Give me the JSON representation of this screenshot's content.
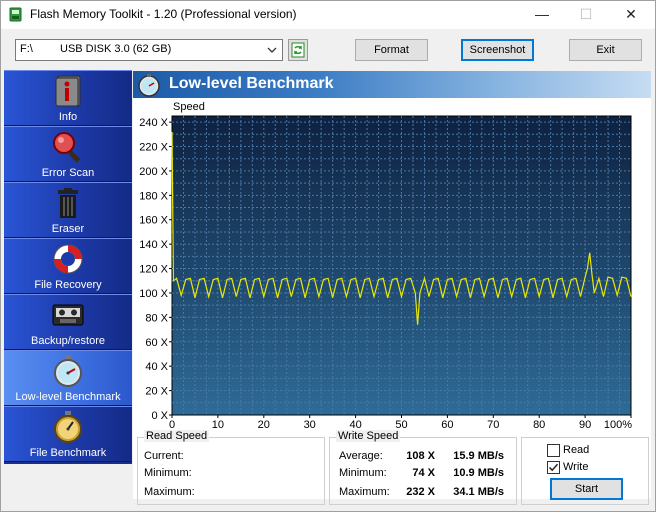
{
  "window": {
    "title": "Flash Memory Toolkit - 1.20 (Professional version)",
    "minimize_glyph": "—",
    "maximize_glyph": "☐",
    "close_glyph": "✕"
  },
  "toolbar": {
    "drive_letter": "F:\\",
    "drive_name": "USB DISK 3.0 (62 GB)",
    "format_label": "Format",
    "screenshot_label": "Screenshot",
    "exit_label": "Exit"
  },
  "sidebar": {
    "items": [
      {
        "label": "Info",
        "icon": "info-icon"
      },
      {
        "label": "Error Scan",
        "icon": "magnifier-icon"
      },
      {
        "label": "Eraser",
        "icon": "trash-icon"
      },
      {
        "label": "File Recovery",
        "icon": "lifebuoy-icon"
      },
      {
        "label": "Backup/restore",
        "icon": "tape-icon"
      },
      {
        "label": "Low-level Benchmark",
        "icon": "stopwatch-icon"
      },
      {
        "label": "File Benchmark",
        "icon": "stopwatch-gold-icon"
      }
    ],
    "active_index": 5
  },
  "main": {
    "title": "Low-level Benchmark"
  },
  "chart_data": {
    "type": "line",
    "ylabel": "Speed",
    "xlabel": "",
    "x_ticks": [
      "0",
      "10",
      "20",
      "30",
      "40",
      "50",
      "60",
      "70",
      "80",
      "90",
      "100%"
    ],
    "y_ticks": [
      "0 X",
      "20 X",
      "40 X",
      "60 X",
      "80 X",
      "100 X",
      "120 X",
      "140 X",
      "160 X",
      "180 X",
      "200 X",
      "220 X",
      "240 X"
    ],
    "xlim": [
      0,
      100
    ],
    "ylim": [
      0,
      245
    ],
    "grid": true,
    "series": [
      {
        "color": "#e8e800",
        "points": [
          [
            0,
            232
          ],
          [
            0.3,
            110
          ],
          [
            1,
            112
          ],
          [
            2,
            98
          ],
          [
            3,
            111
          ],
          [
            4,
            112
          ],
          [
            5,
            96
          ],
          [
            6,
            111
          ],
          [
            7,
            112
          ],
          [
            8,
            97
          ],
          [
            9,
            111
          ],
          [
            10,
            112
          ],
          [
            11,
            96
          ],
          [
            12,
            111
          ],
          [
            13,
            112
          ],
          [
            14,
            97
          ],
          [
            15,
            111
          ],
          [
            16,
            112
          ],
          [
            17,
            96
          ],
          [
            18,
            111
          ],
          [
            19,
            112
          ],
          [
            20,
            97
          ],
          [
            21,
            111
          ],
          [
            22,
            112
          ],
          [
            23,
            96
          ],
          [
            24,
            111
          ],
          [
            25,
            112
          ],
          [
            26,
            97
          ],
          [
            27,
            111
          ],
          [
            28,
            112
          ],
          [
            29,
            96
          ],
          [
            30,
            111
          ],
          [
            31,
            112
          ],
          [
            32,
            97
          ],
          [
            33,
            111
          ],
          [
            34,
            112
          ],
          [
            35,
            96
          ],
          [
            36,
            111
          ],
          [
            37,
            112
          ],
          [
            38,
            97
          ],
          [
            39,
            111
          ],
          [
            40,
            112
          ],
          [
            41,
            96
          ],
          [
            42,
            111
          ],
          [
            43,
            112
          ],
          [
            44,
            97
          ],
          [
            45,
            111
          ],
          [
            46,
            112
          ],
          [
            47,
            96
          ],
          [
            48,
            111
          ],
          [
            49,
            112
          ],
          [
            50,
            97
          ],
          [
            51,
            111
          ],
          [
            52,
            112
          ],
          [
            53,
            100
          ],
          [
            53.5,
            74
          ],
          [
            54,
            100
          ],
          [
            55,
            112
          ],
          [
            56,
            97
          ],
          [
            57,
            111
          ],
          [
            58,
            112
          ],
          [
            59,
            96
          ],
          [
            60,
            111
          ],
          [
            61,
            112
          ],
          [
            62,
            97
          ],
          [
            63,
            111
          ],
          [
            64,
            112
          ],
          [
            65,
            96
          ],
          [
            66,
            111
          ],
          [
            67,
            112
          ],
          [
            68,
            97
          ],
          [
            69,
            111
          ],
          [
            70,
            112
          ],
          [
            71,
            96
          ],
          [
            72,
            111
          ],
          [
            73,
            112
          ],
          [
            74,
            97
          ],
          [
            75,
            111
          ],
          [
            76,
            112
          ],
          [
            77,
            96
          ],
          [
            78,
            111
          ],
          [
            79,
            112
          ],
          [
            80,
            97
          ],
          [
            81,
            111
          ],
          [
            82,
            112
          ],
          [
            83,
            96
          ],
          [
            84,
            111
          ],
          [
            85,
            112
          ],
          [
            86,
            97
          ],
          [
            87,
            111
          ],
          [
            88,
            112
          ],
          [
            89,
            97
          ],
          [
            90,
            113
          ],
          [
            90.5,
            120
          ],
          [
            91,
            133
          ],
          [
            91.5,
            115
          ],
          [
            92,
            100
          ],
          [
            93,
            112
          ],
          [
            94,
            97
          ],
          [
            95,
            113
          ],
          [
            96,
            112
          ],
          [
            97,
            98
          ],
          [
            98,
            113
          ],
          [
            99,
            112
          ],
          [
            100,
            97
          ]
        ]
      }
    ]
  },
  "read_speed": {
    "title": "Read Speed",
    "current_label": "Current:",
    "minimum_label": "Minimum:",
    "maximum_label": "Maximum:"
  },
  "write_speed": {
    "title": "Write Speed",
    "average_label": "Average:",
    "average_x": "108 X",
    "average_mbs": "15.9 MB/s",
    "minimum_label": "Minimum:",
    "minimum_x": "74 X",
    "minimum_mbs": "10.9 MB/s",
    "maximum_label": "Maximum:",
    "maximum_x": "232 X",
    "maximum_mbs": "34.1 MB/s"
  },
  "options": {
    "read_label": "Read",
    "read_checked": false,
    "write_label": "Write",
    "write_checked": true,
    "start_label": "Start"
  }
}
